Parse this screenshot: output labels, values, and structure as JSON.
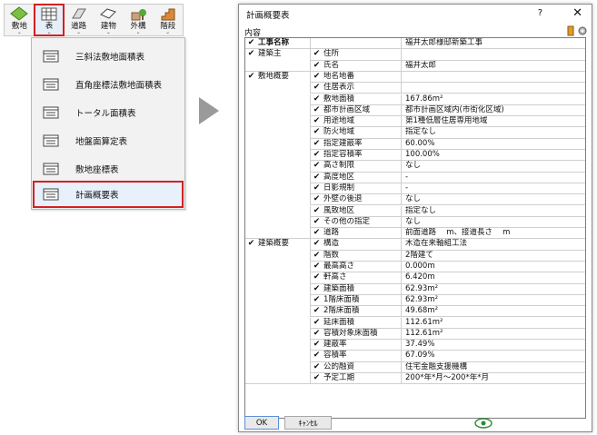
{
  "toolbar": {
    "buttons": [
      {
        "label": "敷地"
      },
      {
        "label": "表"
      },
      {
        "label": "道路"
      },
      {
        "label": "建物"
      },
      {
        "label": "外構"
      },
      {
        "label": "階段"
      }
    ]
  },
  "menu": {
    "items": [
      {
        "label": "三斜法敷地面積表"
      },
      {
        "label": "直角座標法敷地面積表"
      },
      {
        "label": "トータル面積表"
      },
      {
        "label": "地盤面算定表"
      },
      {
        "label": "敷地座標表"
      },
      {
        "label": "計画概要表"
      }
    ]
  },
  "dialog": {
    "title": "計画概要表",
    "help": "?",
    "close": "✕",
    "content_label": "内容",
    "ok": "OK",
    "cancel": "ｷｬﾝｾﾙ",
    "rows": [
      {
        "g": "工事名称",
        "i": "",
        "v": "福井太郎様邸新築工事"
      },
      {
        "g": "建築主",
        "i": "住所",
        "v": ""
      },
      {
        "g": "",
        "i": "氏名",
        "v": "福井太郎"
      },
      {
        "g": "敷地概要",
        "i": "地名地番",
        "v": ""
      },
      {
        "g": "",
        "i": "住居表示",
        "v": ""
      },
      {
        "g": "",
        "i": "敷地面積",
        "v": "167.86m²"
      },
      {
        "g": "",
        "i": "都市計画区域",
        "v": "都市計画区域内(市街化区域)"
      },
      {
        "g": "",
        "i": "用途地域",
        "v": "第1種低層住居専用地域"
      },
      {
        "g": "",
        "i": "防火地域",
        "v": "指定なし"
      },
      {
        "g": "",
        "i": "指定建蔽率",
        "v": "60.00%"
      },
      {
        "g": "",
        "i": "指定容積率",
        "v": "100.00%"
      },
      {
        "g": "",
        "i": "高さ制限",
        "v": "なし"
      },
      {
        "g": "",
        "i": "高度地区",
        "v": "-"
      },
      {
        "g": "",
        "i": "日影規制",
        "v": "-"
      },
      {
        "g": "",
        "i": "外壁の後退",
        "v": "なし"
      },
      {
        "g": "",
        "i": "風致地区",
        "v": "指定なし"
      },
      {
        "g": "",
        "i": "その他の指定",
        "v": "なし"
      },
      {
        "g": "",
        "i": "道路",
        "v": "前面道路　 m、接道長さ　 m"
      },
      {
        "g": "建築概要",
        "i": "構造",
        "v": "木造在来軸組工法"
      },
      {
        "g": "",
        "i": "階数",
        "v": "2階建て"
      },
      {
        "g": "",
        "i": "最高高さ",
        "v": "0.000m"
      },
      {
        "g": "",
        "i": "軒高さ",
        "v": "6.420m"
      },
      {
        "g": "",
        "i": "建築面積",
        "v": "62.93m²"
      },
      {
        "g": "",
        "i": "1階床面積",
        "v": "62.93m²"
      },
      {
        "g": "",
        "i": "2階床面積",
        "v": "49.68m²"
      },
      {
        "g": "",
        "i": "延床面積",
        "v": "112.61m²"
      },
      {
        "g": "",
        "i": "容積対象床面積",
        "v": "112.61m²"
      },
      {
        "g": "",
        "i": "建蔽率",
        "v": "37.49%"
      },
      {
        "g": "",
        "i": "容積率",
        "v": "67.09%"
      },
      {
        "g": "",
        "i": "公的融資",
        "v": "住宅金融支援機構"
      },
      {
        "g": "",
        "i": "予定工期",
        "v": "200*年*月～200*年*月"
      }
    ]
  },
  "colors": {
    "highlight": "#d42020",
    "arrow": "#9a9a9a"
  }
}
